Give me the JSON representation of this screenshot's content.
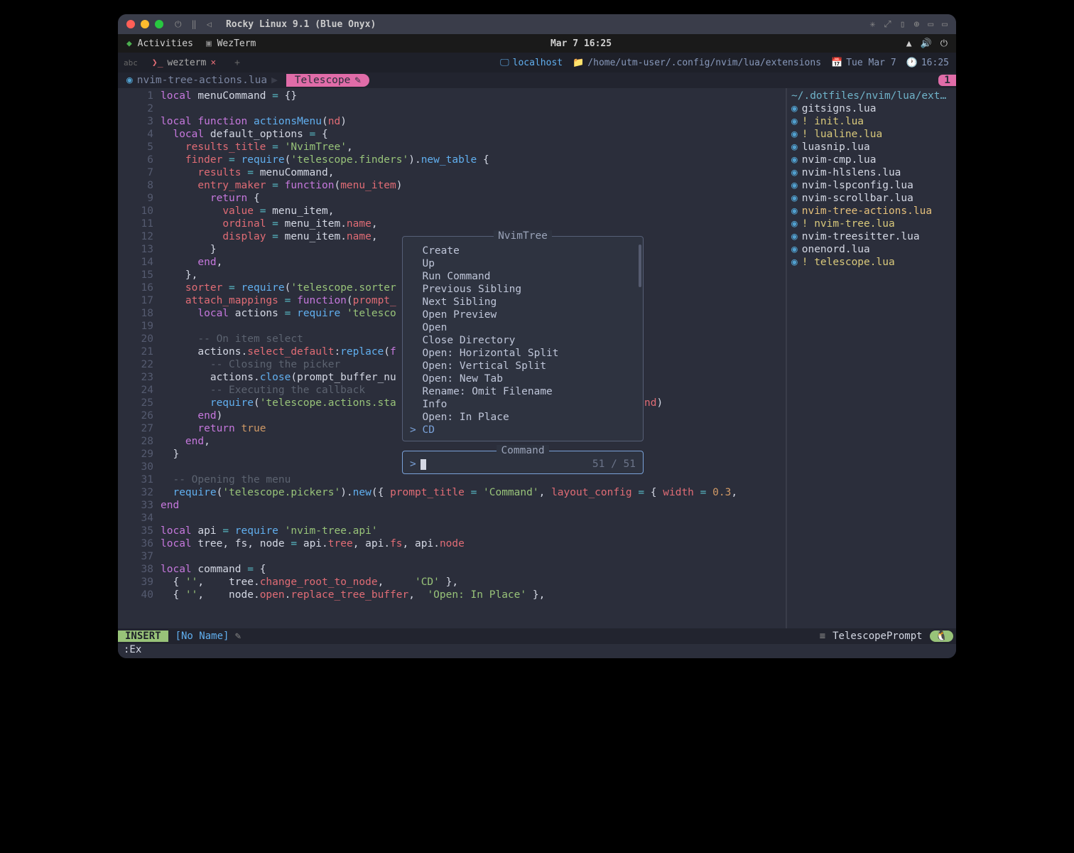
{
  "titlebar": {
    "title": "Rocky Linux 9.1 (Blue Onyx)"
  },
  "gnome": {
    "activities": "Activities",
    "app": "WezTerm",
    "clock": "Mar 7  16:25"
  },
  "tabbar": {
    "abc": "abc",
    "tab_label": "wezterm",
    "host": "localhost",
    "path": "/home/utm-user/.config/nvim/lua/extensions",
    "date": "Tue Mar 7",
    "time": "16:25"
  },
  "bufferline": {
    "tab1": "nvim-tree-actions.lua",
    "tab2": "Telescope ",
    "right": "1"
  },
  "sidebar": {
    "path": "~/.dotfiles/nvim/lua/ext…",
    "files": [
      {
        "name": "gitsigns.lua",
        "mod": false
      },
      {
        "name": "! init.lua",
        "mod": true
      },
      {
        "name": "! lualine.lua",
        "mod": true
      },
      {
        "name": "luasnip.lua",
        "mod": false
      },
      {
        "name": "nvim-cmp.lua",
        "mod": false
      },
      {
        "name": "nvim-hlslens.lua",
        "mod": false
      },
      {
        "name": "nvim-lspconfig.lua",
        "mod": false
      },
      {
        "name": "nvim-scrollbar.lua",
        "mod": false
      },
      {
        "name": "nvim-tree-actions.lua",
        "mod": false,
        "hl": true
      },
      {
        "name": "! nvim-tree.lua",
        "mod": true
      },
      {
        "name": "nvim-treesitter.lua",
        "mod": false
      },
      {
        "name": "onenord.lua",
        "mod": false
      },
      {
        "name": "! telescope.lua",
        "mod": true
      }
    ]
  },
  "popup": {
    "title": "NvimTree",
    "items": [
      "Create",
      "Up",
      "Run Command",
      "Previous Sibling",
      "Next Sibling",
      "Open Preview",
      "Open",
      "Close Directory",
      "Open: Horizontal Split",
      "Open: Vertical Split",
      "Open: New Tab",
      "Rename: Omit Filename",
      "Info",
      "Open: In Place"
    ],
    "selected": "CD"
  },
  "prompt": {
    "title": "Command",
    "value": "",
    "count": "51 / 51"
  },
  "statusline": {
    "mode": "INSERT",
    "name": "[No Name]",
    "filetype": "TelescopePrompt"
  },
  "cmdline": ":Ex",
  "code_lines": [
    {
      "n": 1,
      "html": "<span class='kw'>local</span> <span class='id'>menuCommand</span> <span class='op'>=</span> {}"
    },
    {
      "n": 2,
      "html": ""
    },
    {
      "n": 3,
      "html": "<span class='kw'>local</span> <span class='kw'>function</span> <span class='fn'>actionsMenu</span>(<span class='prop'>nd</span>)"
    },
    {
      "n": 4,
      "html": "  <span class='kw'>local</span> <span class='id'>default_options</span> <span class='op'>=</span> {"
    },
    {
      "n": 5,
      "html": "    <span class='prop'>results_title</span> <span class='op'>=</span> <span class='str'>'NvimTree'</span>,"
    },
    {
      "n": 6,
      "html": "    <span class='prop'>finder</span> <span class='op'>=</span> <span class='fn'>require</span>(<span class='str'>'telescope.finders'</span>).<span class='fn'>new_table</span> {"
    },
    {
      "n": 7,
      "html": "      <span class='prop'>results</span> <span class='op'>=</span> menuCommand,"
    },
    {
      "n": 8,
      "html": "      <span class='prop'>entry_maker</span> <span class='op'>=</span> <span class='kw'>function</span>(<span class='prop'>menu_item</span>)"
    },
    {
      "n": 9,
      "html": "        <span class='kw'>return</span> {"
    },
    {
      "n": 10,
      "html": "          <span class='prop'>value</span> <span class='op'>=</span> menu_item,"
    },
    {
      "n": 11,
      "html": "          <span class='prop'>ordinal</span> <span class='op'>=</span> menu_item.<span class='prop'>name</span>,"
    },
    {
      "n": 12,
      "html": "          <span class='prop'>display</span> <span class='op'>=</span> menu_item.<span class='prop'>name</span>,"
    },
    {
      "n": 13,
      "html": "        }"
    },
    {
      "n": 14,
      "html": "      <span class='kw'>end</span>,"
    },
    {
      "n": 15,
      "html": "    },"
    },
    {
      "n": 16,
      "html": "    <span class='prop'>sorter</span> <span class='op'>=</span> <span class='fn'>require</span>(<span class='str'>'telescope.sorter"
    },
    {
      "n": 17,
      "html": "    <span class='prop'>attach_mappings</span> <span class='op'>=</span> <span class='kw'>function</span>(<span class='prop'>prompt_</span>"
    },
    {
      "n": 18,
      "html": "      <span class='kw'>local</span> <span class='id'>actions</span> <span class='op'>=</span> <span class='fn'>require</span> <span class='str'>'telesco"
    },
    {
      "n": 19,
      "html": ""
    },
    {
      "n": 20,
      "html": "      <span class='cm'>-- On item select</span>"
    },
    {
      "n": 21,
      "html": "      actions.<span class='prop'>select_default</span>:<span class='fn'>replace</span>(<span class='kw'>f</span>"
    },
    {
      "n": 22,
      "html": "        <span class='cm'>-- Closing the picker</span>"
    },
    {
      "n": 23,
      "html": "        actions.<span class='fn'>close</span>(prompt_buffer_nu"
    },
    {
      "n": 24,
      "html": "        <span class='cm'>-- Executing the callback</span>"
    },
    {
      "n": 25,
      "html": "        <span class='fn'>require</span>(<span class='str'>'telescope.actions.sta</span>                                     <span class='id'>er</span>(<span class='prop'>nd</span>)"
    },
    {
      "n": 26,
      "html": "      <span class='kw'>end</span>)"
    },
    {
      "n": 27,
      "html": "      <span class='kw'>return</span> <span class='bool'>true</span>"
    },
    {
      "n": 28,
      "html": "    <span class='kw'>end</span>,"
    },
    {
      "n": 29,
      "html": "  }"
    },
    {
      "n": 30,
      "html": ""
    },
    {
      "n": 31,
      "html": "  <span class='cm'>-- Opening the menu</span>"
    },
    {
      "n": 32,
      "html": "  <span class='fn'>require</span>(<span class='str'>'telescope.pickers'</span>).<span class='fn'>new</span>({ <span class='prop'>prompt_title</span> <span class='op'>=</span> <span class='str'>'Command'</span>, <span class='prop'>layout_config</span> <span class='op'>=</span> { <span class='prop'>width</span> <span class='op'>=</span> <span class='num'>0.3</span>,"
    },
    {
      "n": 33,
      "html": "<span class='kw'>end</span>"
    },
    {
      "n": 34,
      "html": ""
    },
    {
      "n": 35,
      "html": "<span class='kw'>local</span> <span class='id'>api</span> <span class='op'>=</span> <span class='fn'>require</span> <span class='str'>'nvim-tree.api'</span>"
    },
    {
      "n": 36,
      "html": "<span class='kw'>local</span> <span class='id'>tree</span>, <span class='id'>fs</span>, <span class='id'>node</span> <span class='op'>=</span> api.<span class='prop'>tree</span>, api.<span class='prop'>fs</span>, api.<span class='prop'>node</span>"
    },
    {
      "n": 37,
      "html": ""
    },
    {
      "n": 38,
      "html": "<span class='kw'>local</span> <span class='id'>command</span> <span class='op'>=</span> {"
    },
    {
      "n": 39,
      "html": "  { <span class='str'>''</span>,    tree.<span class='prop'>change_root_to_node</span>,     <span class='str'>'CD'</span> },"
    },
    {
      "n": 40,
      "html": "  { <span class='str'>''</span>,    node.<span class='prop'>open</span>.<span class='prop'>replace_tree_buffer</span>,  <span class='str'>'Open: In Place'</span> },"
    }
  ]
}
